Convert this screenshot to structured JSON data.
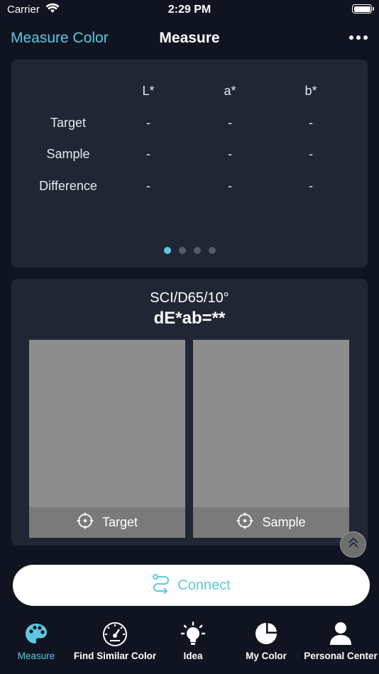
{
  "status": {
    "carrier": "Carrier",
    "time": "2:29 PM"
  },
  "nav": {
    "back_label": "Measure Color",
    "title": "Measure",
    "more_icon": "more-horizontal-icon"
  },
  "table": {
    "headers": [
      "L*",
      "a*",
      "b*"
    ],
    "rows": [
      {
        "label": "Target",
        "values": [
          "-",
          "-",
          "-"
        ]
      },
      {
        "label": "Sample",
        "values": [
          "-",
          "-",
          "-"
        ]
      },
      {
        "label": "Difference",
        "values": [
          "-",
          "-",
          "-"
        ]
      }
    ],
    "pages": 4,
    "active_page": 0
  },
  "compare": {
    "mode": "SCI/D65/10°",
    "delta": "dE*ab=**",
    "target_label": "Target",
    "sample_label": "Sample",
    "swatch_color": "#8d8d8d"
  },
  "connect_label": "Connect",
  "tabs": [
    {
      "label": "Measure",
      "icon": "palette-icon",
      "active": true
    },
    {
      "label": "Find Similar Color",
      "icon": "gauge-icon",
      "active": false
    },
    {
      "label": "Idea",
      "icon": "lightbulb-icon",
      "active": false
    },
    {
      "label": "My Color",
      "icon": "pie-chart-icon",
      "active": false
    },
    {
      "label": "Personal Center",
      "icon": "person-icon",
      "active": false
    }
  ],
  "colors": {
    "accent": "#5ec8e0",
    "background": "#0f1420",
    "card": "#212634"
  }
}
